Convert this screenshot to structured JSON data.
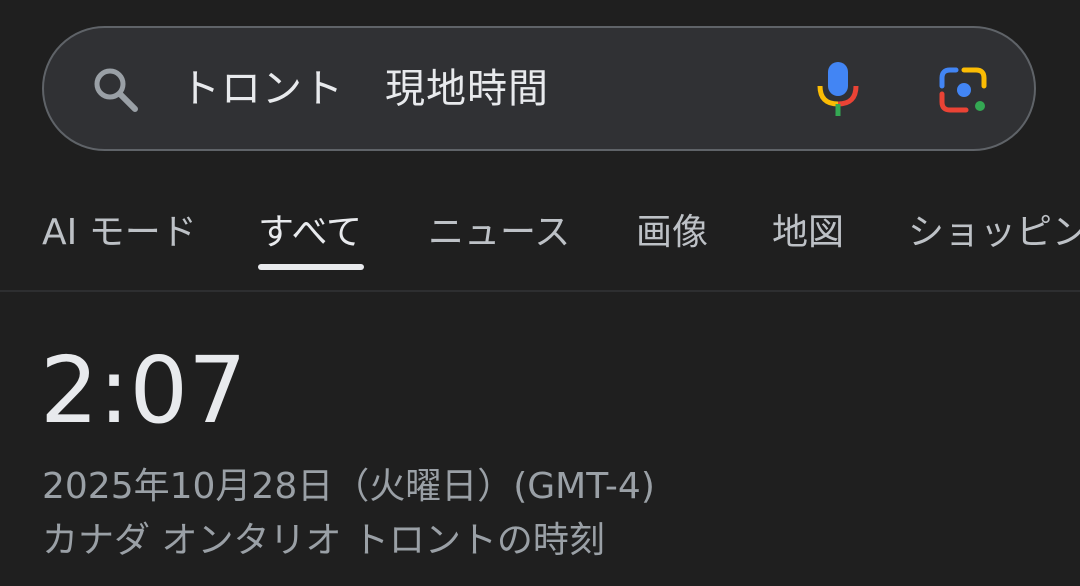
{
  "search": {
    "query": "トロント　現地時間"
  },
  "tabs": [
    {
      "label": "AI モード"
    },
    {
      "label": "すべて",
      "active": true
    },
    {
      "label": "ニュース"
    },
    {
      "label": "画像"
    },
    {
      "label": "地図"
    },
    {
      "label": "ショッピング"
    }
  ],
  "result": {
    "time": "2:07",
    "date": "2025年10月28日（火曜日）(GMT-4)",
    "location": "カナダ オンタリオ トロントの時刻"
  },
  "colors": {
    "background": "#1f1f1f",
    "search_bar": "#303134",
    "text_primary": "#e8eaed",
    "text_secondary": "#9aa0a6",
    "google_blue": "#4285f4",
    "google_red": "#ea4335",
    "google_yellow": "#fbbc04",
    "google_green": "#34a853"
  },
  "icons": {
    "search": "search-icon",
    "mic": "microphone-icon",
    "lens": "google-lens-icon"
  }
}
